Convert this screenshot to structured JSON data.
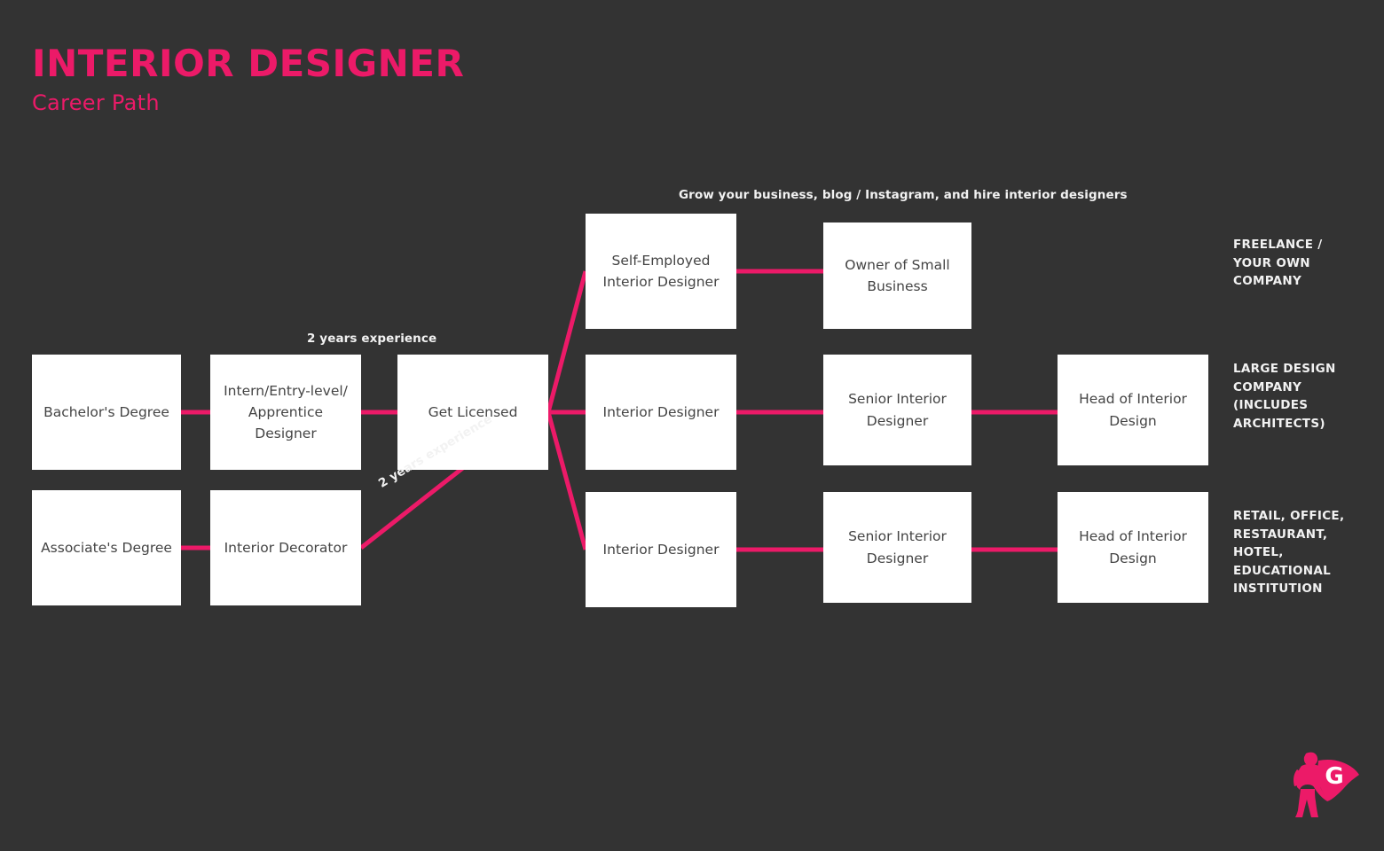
{
  "header": {
    "title": "INTERIOR DESIGNER",
    "subtitle": "Career Path"
  },
  "colors": {
    "background": "#333333",
    "accent_pink": "#ec1a68",
    "node_fill": "#ffffff",
    "node_text": "#444444",
    "label_text": "#f2f2f2"
  },
  "notes": {
    "grow_business": "Grow your business, blog / Instagram, and hire interior designers",
    "edge_top": "2 years experience",
    "edge_diagonal": "2 years experience"
  },
  "nodes": {
    "bachelors_degree": "Bachelor's Degree",
    "intern_entry": "Intern/Entry-level/\nApprentice\nDesigner",
    "get_licensed": "Get Licensed",
    "associates_degree": "Associate's Degree",
    "interior_decorator": "Interior Decorator",
    "self_employed": "Self-Employed\nInterior Designer",
    "owner_small_business": "Owner of Small\nBusiness",
    "interior_designer_mid": "Interior Designer",
    "senior_interior_designer_mid": "Senior Interior\nDesigner",
    "head_of_interior_design_mid": "Head of Interior\nDesign",
    "interior_designer_bottom": "Interior Designer",
    "senior_interior_designer_bottom": "Senior Interior\nDesigner",
    "head_of_interior_design_bottom": "Head of Interior\nDesign"
  },
  "categories": {
    "freelance": "FREELANCE /\nYOUR OWN\nCOMPANY",
    "large_design": "LARGE DESIGN\nCOMPANY\n(INCLUDES\nARCHITECTS)",
    "retail": "RETAIL, OFFICE,\nRESTAURANT,\nHOTEL,\nEDUCATIONAL\nINSTITUTION"
  },
  "logo": {
    "letter": "G",
    "icon": "superhero-icon"
  }
}
